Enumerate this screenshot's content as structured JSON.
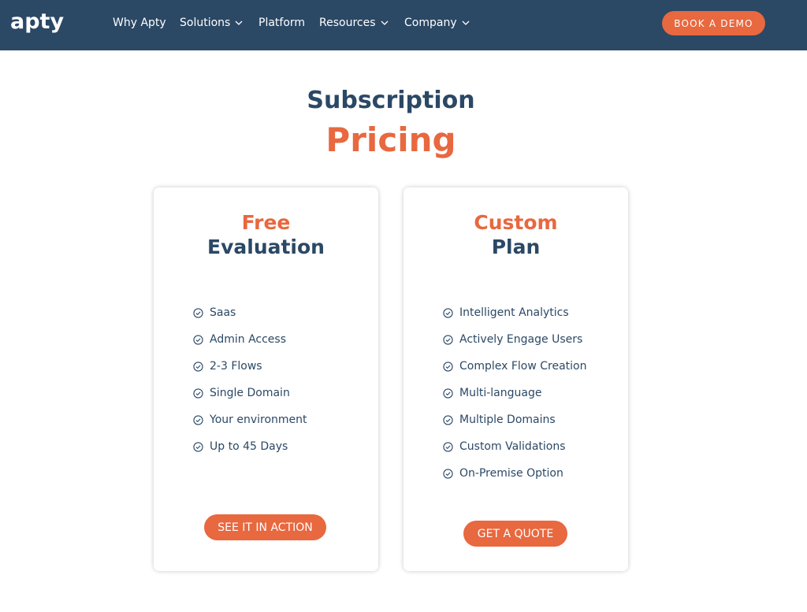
{
  "header": {
    "logo": "apty",
    "nav": [
      {
        "label": "Why Apty",
        "has_dropdown": false
      },
      {
        "label": "Solutions",
        "has_dropdown": true
      },
      {
        "label": "Platform",
        "has_dropdown": false
      },
      {
        "label": "Resources",
        "has_dropdown": true
      },
      {
        "label": "Company",
        "has_dropdown": true
      }
    ],
    "cta_label": "BOOK A DEMO"
  },
  "hero": {
    "line1": "Subscription",
    "line2": "Pricing"
  },
  "plans": [
    {
      "title_accent": "Free",
      "title_main": "Evaluation",
      "features": [
        "Saas",
        "Admin Access",
        "2-3 Flows",
        "Single Domain",
        "Your environment",
        "Up to 45 Days"
      ],
      "cta_label": "SEE IT IN ACTION"
    },
    {
      "title_accent": "Custom",
      "title_main": "Plan",
      "features": [
        "Intelligent Analytics",
        "Actively Engage Users",
        "Complex Flow Creation",
        "Multi-language",
        "Multiple Domains",
        "Custom Validations",
        "On-Premise Option"
      ],
      "cta_label": "GET A QUOTE"
    }
  ],
  "colors": {
    "navy": "#2b4865",
    "accent": "#e8683f",
    "background": "#ffffff"
  },
  "icons": {
    "nav_dropdown": "chevron-down-icon",
    "feature_bullet": "check-circle-icon"
  }
}
